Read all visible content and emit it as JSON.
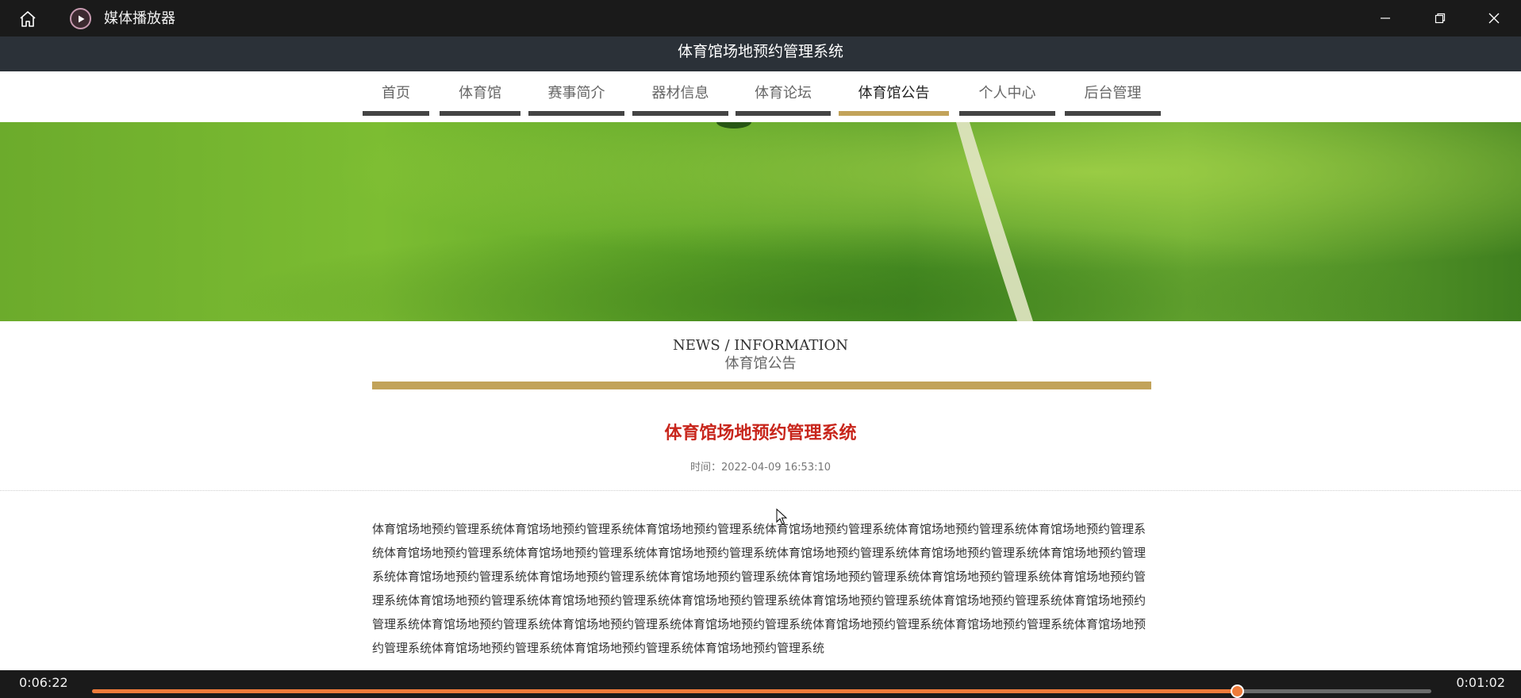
{
  "player": {
    "app_title": "媒体播放器",
    "icons": {
      "home": "home-icon",
      "app": "play-icon",
      "minimize": "minimize-icon",
      "restore": "restore-icon",
      "close": "close-icon"
    },
    "current_time": "0:06:22",
    "remaining_time": "0:01:02",
    "progress": 0.855,
    "accent_color": "#ef7b3a"
  },
  "site": {
    "header_title": "体育馆场地预约管理系统",
    "nav": [
      {
        "label": "首页",
        "active": false
      },
      {
        "label": "体育馆",
        "active": false
      },
      {
        "label": "赛事简介",
        "active": false
      },
      {
        "label": "器材信息",
        "active": false
      },
      {
        "label": "体育论坛",
        "active": false
      },
      {
        "label": "体育馆公告",
        "active": true
      },
      {
        "label": "个人中心",
        "active": false
      },
      {
        "label": "后台管理",
        "active": false
      }
    ],
    "active_color": "#c2a35a",
    "section_heading_en": "NEWS / INFORMATION",
    "section_heading_cn": "体育馆公告",
    "article": {
      "title": "体育馆场地预约管理系统",
      "time": "时间：2022-04-09 16:53:10",
      "body": "体育馆场地预约管理系统体育馆场地预约管理系统体育馆场地预约管理系统体育馆场地预约管理系统体育馆场地预约管理系统体育馆场地预约管理系统体育馆场地预约管理系统体育馆场地预约管理系统体育馆场地预约管理系统体育馆场地预约管理系统体育馆场地预约管理系统体育馆场地预约管理系统体育馆场地预约管理系统体育馆场地预约管理系统体育馆场地预约管理系统体育馆场地预约管理系统体育馆场地预约管理系统体育馆场地预约管理系统体育馆场地预约管理系统体育馆场地预约管理系统体育馆场地预约管理系统体育馆场地预约管理系统体育馆场地预约管理系统体育馆场地预约管理系统体育馆场地预约管理系统体育馆场地预约管理系统体育馆场地预约管理系统体育馆场地预约管理系统体育馆场地预约管理系统体育馆场地预约管理系统体育馆场地预约管理系统体育馆场地预约管理系统体育馆场地预约管理系统"
    }
  }
}
